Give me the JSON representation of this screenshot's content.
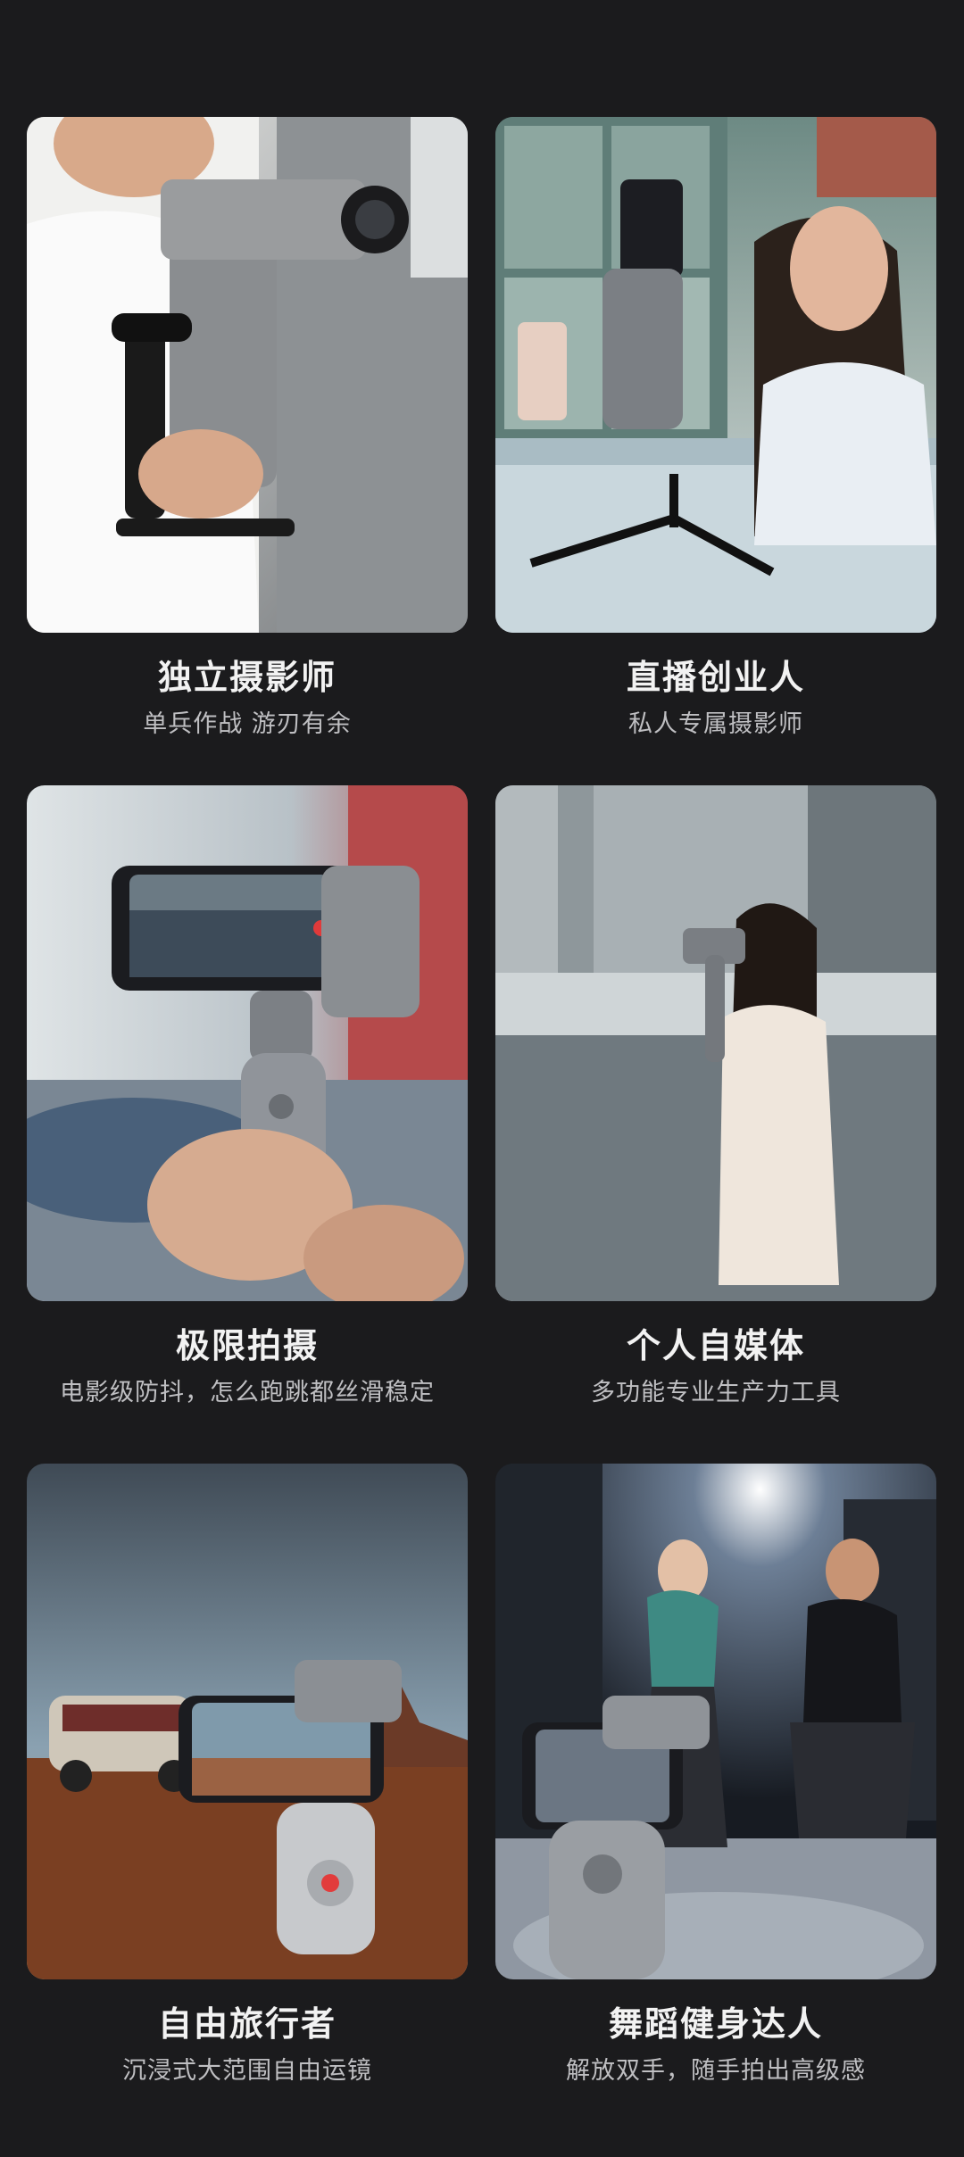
{
  "cards": [
    {
      "title": "独立摄影师",
      "subtitle": "单兵作战 游刃有余",
      "image": "photographer-with-gimbal-photo"
    },
    {
      "title": "直播创业人",
      "subtitle": "私人专属摄影师",
      "image": "livestreamer-with-gimbal-photo"
    },
    {
      "title": "极限拍摄",
      "subtitle": "电影级防抖，怎么跑跳都丝滑稳定",
      "image": "hands-holding-gimbal-photo"
    },
    {
      "title": "个人自媒体",
      "subtitle": "多功能专业生产力工具",
      "image": "selfie-with-gimbal-photo"
    },
    {
      "title": "自由旅行者",
      "subtitle": "沉浸式大范围自由运镜",
      "image": "desert-travel-gimbal-photo"
    },
    {
      "title": "舞蹈健身达人",
      "subtitle": "解放双手，随手拍出高级感",
      "image": "gym-fitness-gimbal-photo"
    }
  ],
  "colors": {
    "background": "#1b1b1d",
    "title": "#f2f2f2",
    "subtitle": "#bfbfc2"
  }
}
